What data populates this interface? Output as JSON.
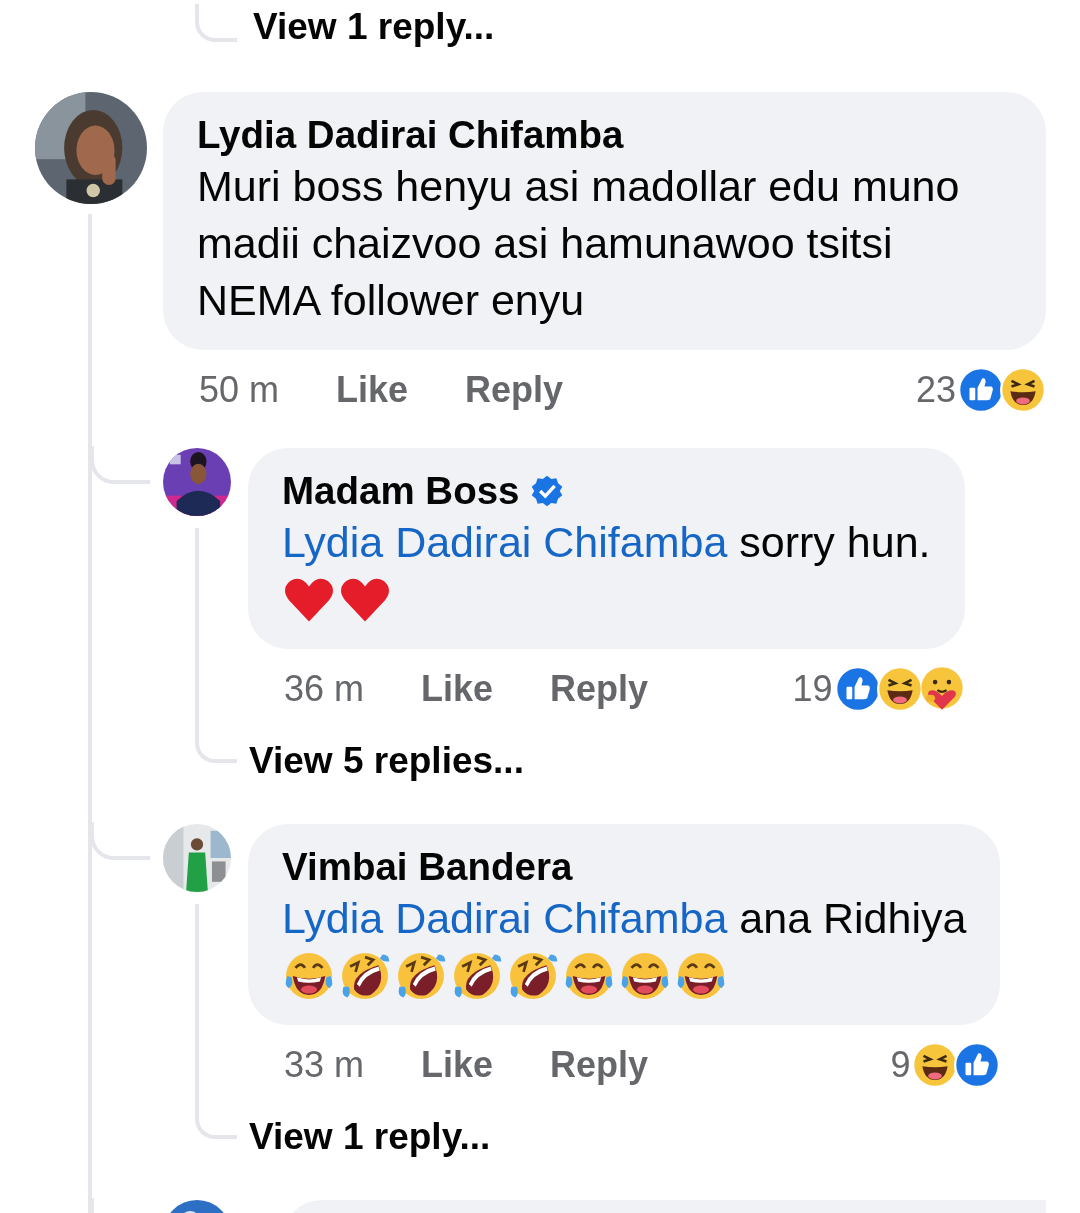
{
  "top_link": {
    "label": "View 1 reply..."
  },
  "comment": {
    "author": "Lydia Dadirai Chifamba",
    "text": "Muri boss henyu asi madollar edu muno madii chaizvoo asi hamunawoo tsitsi NEMA follower enyu",
    "time": "50 m",
    "actions": [
      "Like",
      "Reply"
    ],
    "reaction_count": "23",
    "reactions": [
      {
        "kind": "like"
      },
      {
        "kind": "haha"
      }
    ],
    "replies": [
      {
        "cut_off": false,
        "author": "Madam Boss",
        "verified": true,
        "mention": "Lydia Dadirai Chifamba",
        "text": "sorry hun.",
        "emojis": [
          {
            "kind": "heart"
          },
          {
            "kind": "heart"
          }
        ],
        "time": "36 m",
        "actions": [
          "Like",
          "Reply"
        ],
        "reaction_count": "19",
        "reactions": [
          {
            "kind": "like"
          },
          {
            "kind": "haha"
          },
          {
            "kind": "care"
          }
        ],
        "more_link": "View 5 replies..."
      },
      {
        "cut_off": false,
        "author": "Vimbai Bandera",
        "verified": false,
        "mention": "Lydia Dadirai Chifamba",
        "text": "ana Ridhiya",
        "emojis": [
          {
            "kind": "tears-of-joy"
          },
          {
            "kind": "rolling-laughing"
          },
          {
            "kind": "rolling-laughing"
          },
          {
            "kind": "rolling-laughing"
          },
          {
            "kind": "rolling-laughing"
          },
          {
            "kind": "tears-of-joy"
          },
          {
            "kind": "tears-of-joy"
          },
          {
            "kind": "tears-of-joy"
          }
        ],
        "time": "33 m",
        "actions": [
          "Like",
          "Reply"
        ],
        "reaction_count": "9",
        "reactions": [
          {
            "kind": "haha"
          },
          {
            "kind": "like"
          }
        ],
        "more_link": "View 1 reply..."
      },
      {
        "cut_off": true
      }
    ]
  }
}
